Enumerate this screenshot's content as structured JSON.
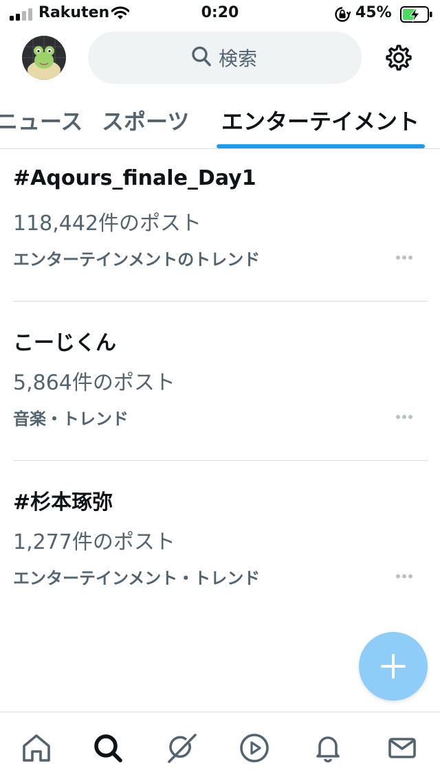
{
  "status_bar": {
    "carrier": "Rakuten",
    "time": "0:20",
    "battery_percent": "45%"
  },
  "header": {
    "search_placeholder": "検索",
    "avatar_icon": "frog-avatar",
    "settings_icon": "gear-icon"
  },
  "tabs": [
    {
      "label": "ニュース",
      "selected": false
    },
    {
      "label": "スポーツ",
      "selected": false
    },
    {
      "label": "エンターテイメント",
      "selected": true
    }
  ],
  "trends": [
    {
      "name": "#Aqours_finale_Day1",
      "count": "118,442件のポスト",
      "context": "エンターテインメントのトレンド"
    },
    {
      "name": "こーじくん",
      "count": "5,864件のポスト",
      "context": "音楽・トレンド"
    },
    {
      "name": "#杉本琢弥",
      "count": "1,277件のポスト",
      "context": "エンターテインメント・トレンド"
    }
  ],
  "fab": {
    "icon": "plus-icon"
  },
  "bottom_nav": [
    {
      "icon": "home-icon"
    },
    {
      "icon": "search-icon"
    },
    {
      "icon": "grok-icon"
    },
    {
      "icon": "video-icon"
    },
    {
      "icon": "bell-icon"
    },
    {
      "icon": "mail-icon"
    }
  ],
  "colors": {
    "accent": "#1d9bf0",
    "fab": "#8ecdf8",
    "secondary_text": "#536471",
    "primary_text": "#0f1419"
  }
}
